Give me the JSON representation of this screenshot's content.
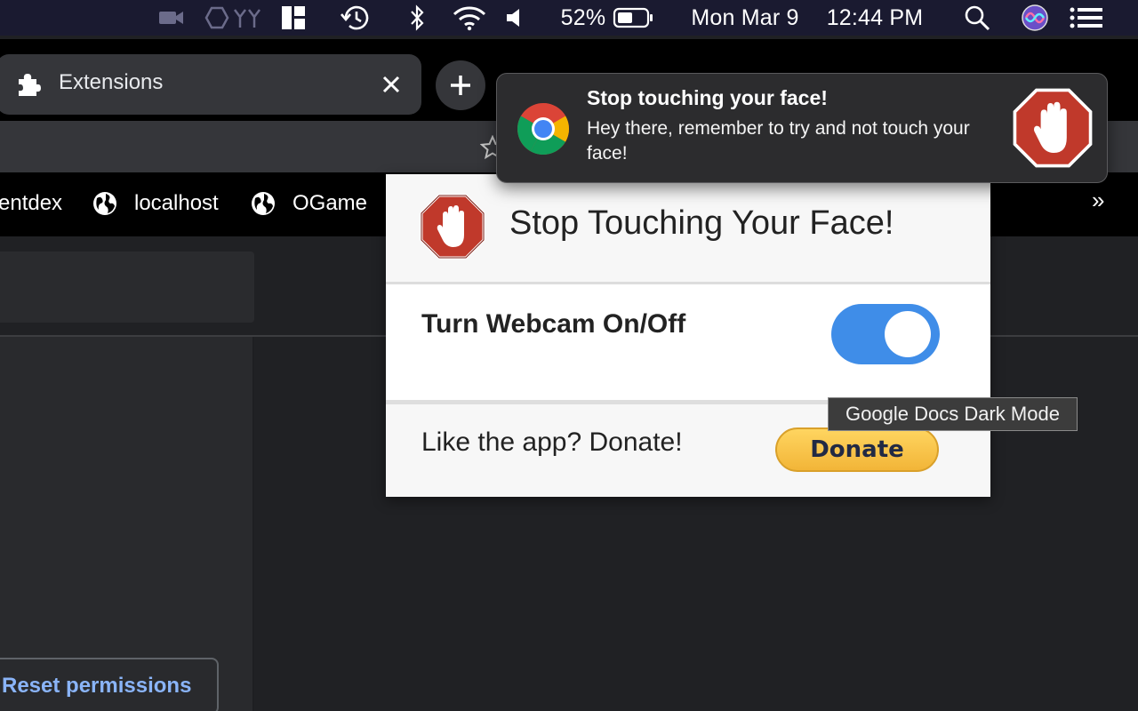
{
  "menubar": {
    "battery_percent": "52%",
    "date": "Mon Mar 9",
    "time": "12:44 PM",
    "icons": [
      "video-icon",
      "extension-shapes-icon",
      "window-manager-icon",
      "time-machine-icon",
      "bluetooth-icon",
      "wifi-icon",
      "volume-icon",
      "battery-icon",
      "spotlight-search-icon",
      "siri-icon",
      "control-center-icon"
    ]
  },
  "browser": {
    "tab": {
      "title": "Extensions",
      "icon": "puzzle-icon"
    },
    "bookmarks": [
      {
        "label": "entdex"
      },
      {
        "label": "localhost"
      },
      {
        "label": "OGame"
      }
    ],
    "bookmarks_overflow": "»"
  },
  "page": {
    "reset_button_label": "Reset permissions"
  },
  "popup": {
    "title": "Stop Touching Your Face!",
    "webcam_label": "Turn Webcam On/Off",
    "webcam_on": true,
    "donate_label": "Like the app? Donate!",
    "donate_button": "Donate"
  },
  "tooltip": {
    "text": "Google Docs Dark Mode"
  },
  "notification": {
    "title": "Stop touching your face!",
    "body": "Hey there, remember to try and not touch your face!"
  },
  "colors": {
    "accent_blue": "#3f8de8",
    "stop_red": "#c0392b",
    "link_blue": "#8ab4f8",
    "donate_yellow": "#f5c242"
  }
}
